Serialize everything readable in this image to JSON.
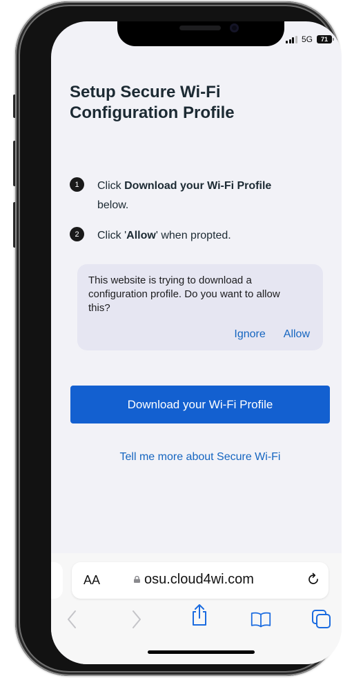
{
  "status": {
    "network": "5G",
    "battery": "71"
  },
  "page": {
    "title": "Setup Secure Wi-Fi Configuration Profile",
    "steps": [
      {
        "number": "1",
        "prefix": "Click ",
        "bold": "Download your Wi-Fi Profile",
        "suffix": " below."
      },
      {
        "number": "2",
        "prefix": "Click '",
        "bold": "Allow",
        "suffix": "' when propted."
      }
    ],
    "prompt": {
      "message": "This website is trying to download a configuration profile. Do you want to allow this?",
      "ignore_label": "Ignore",
      "allow_label": "Allow"
    },
    "download_button": "Download your Wi-Fi Profile",
    "more_link": "Tell me more about Secure Wi-Fi"
  },
  "browser": {
    "text_size_label": "AA",
    "domain": "osu.cloud4wi.com",
    "icons": [
      "back-icon",
      "forward-icon",
      "share-icon",
      "bookmarks-icon",
      "tabs-icon",
      "reload-icon",
      "lock-icon"
    ]
  },
  "colors": {
    "accent": "#1360d0",
    "link": "#1565c0",
    "prompt_bg": "#e6e6f2",
    "title": "#1c2a33"
  }
}
